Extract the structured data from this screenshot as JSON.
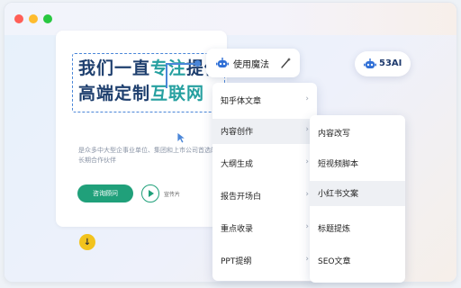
{
  "window": {
    "controls": [
      "close",
      "minimize",
      "maximize"
    ]
  },
  "page": {
    "headline_line1_part1": "我们一直",
    "headline_line1_highlight": "专注",
    "headline_line1_part2": "提供",
    "headline_line2_part1": "高端定制",
    "headline_line2_part2": "互联网",
    "description": "是众多中大型企事业单位、集团和上市公司首选的长期合作伙伴",
    "consult_button": "咨询顾问",
    "promo_label": "宣传片",
    "down_icon": "↓"
  },
  "toolbar": {
    "label": "使用魔法",
    "bot_icon": "robot-icon",
    "wand_icon": "magic-wand-icon"
  },
  "brand": {
    "name": "53AI",
    "icon": "robot-icon"
  },
  "menu_primary": {
    "items": [
      {
        "label": "知乎体文章",
        "has_submenu": true,
        "active": false
      },
      {
        "label": "内容创作",
        "has_submenu": true,
        "active": true
      },
      {
        "label": "大纲生成",
        "has_submenu": true,
        "active": false
      },
      {
        "label": "报告开场白",
        "has_submenu": true,
        "active": false
      },
      {
        "label": "重点收录",
        "has_submenu": true,
        "active": false
      },
      {
        "label": "PPT提纲",
        "has_submenu": true,
        "active": false
      }
    ],
    "chevron": "›"
  },
  "menu_secondary": {
    "items": [
      {
        "label": "内容改写",
        "active": false
      },
      {
        "label": "短视频脚本",
        "active": false
      },
      {
        "label": "小红书文案",
        "active": true
      },
      {
        "label": "标题提炼",
        "active": false
      },
      {
        "label": "SEO文章",
        "active": false
      }
    ]
  },
  "colors": {
    "accent": "#4a86d8",
    "primary_green": "#20a07a",
    "headline": "#1e3f6e",
    "highlight": "#26a0a0",
    "active_row": "#eef0f4"
  }
}
